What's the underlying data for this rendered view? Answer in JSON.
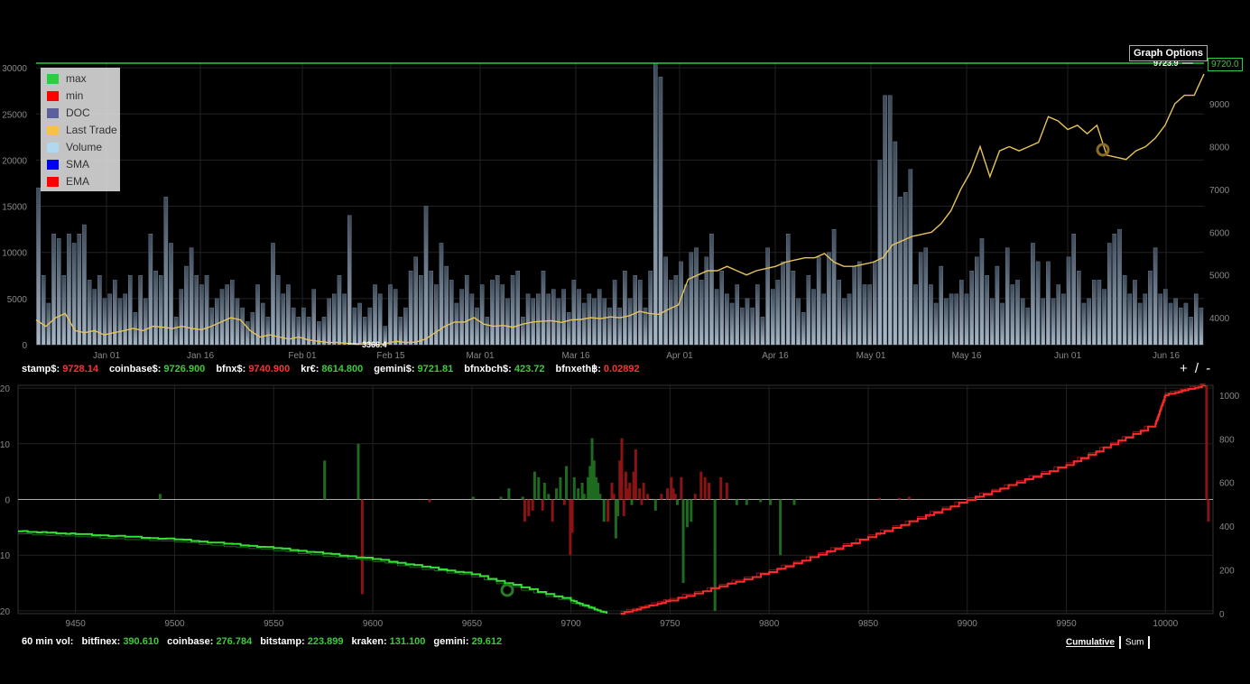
{
  "legend": [
    {
      "label": "max",
      "color": "#2ecc40"
    },
    {
      "label": "min",
      "color": "#ff0000"
    },
    {
      "label": "DOC",
      "color": "#5c5f99"
    },
    {
      "label": "Last Trade",
      "color": "#f5c242"
    },
    {
      "label": "Volume",
      "color": "#b0d8f0"
    },
    {
      "label": "SMA",
      "color": "#0000ff"
    },
    {
      "label": "EMA",
      "color": "#ff0000"
    }
  ],
  "graph_options_label": "Graph Options",
  "current_price_tag": "9720.0",
  "current_price_label": "9723.9",
  "min_price_label": "3366.4",
  "ticker": [
    {
      "label": "stamp$:",
      "value": "9728.14",
      "color": "red"
    },
    {
      "label": "coinbase$:",
      "value": "9726.900",
      "color": "green"
    },
    {
      "label": "bfnx$:",
      "value": "9740.900",
      "color": "red"
    },
    {
      "label": "kr€:",
      "value": "8614.800",
      "color": "green"
    },
    {
      "label": "gemini$:",
      "value": "9721.81",
      "color": "green"
    },
    {
      "label": "bfnxbch$:",
      "value": "423.72",
      "color": "green"
    },
    {
      "label": "bfnxeth฿:",
      "value": "0.02892",
      "color": "red"
    }
  ],
  "zoom_label": "+ / -",
  "volume_line": {
    "prefix": "60 min vol:",
    "items": [
      {
        "label": "bitfinex:",
        "value": "390.610"
      },
      {
        "label": "coinbase:",
        "value": "276.784"
      },
      {
        "label": "bitstamp:",
        "value": "223.899"
      },
      {
        "label": "kraken:",
        "value": "131.100"
      },
      {
        "label": "gemini:",
        "value": "29.612"
      }
    ]
  },
  "mode_cumulative": "Cumulative",
  "mode_sum": "Sum",
  "chart_data": [
    {
      "type": "bar",
      "x_ticks": [
        "Jan 01",
        "Jan 16",
        "Feb 01",
        "Feb 15",
        "Mar 01",
        "Mar 16",
        "Apr 01",
        "Apr 16",
        "May 01",
        "May 16",
        "Jun 01",
        "Jun 16"
      ],
      "y_left_ticks": [
        "0",
        "5000",
        "10000",
        "15000",
        "20000",
        "25000",
        "30000"
      ],
      "y_left_range": [
        0,
        30500
      ],
      "y_right_ticks": [
        "4000",
        "5000",
        "6000",
        "7000",
        "8000",
        "9000"
      ],
      "y_right_range": [
        3370,
        9950
      ],
      "volume_series": [
        17000,
        7500,
        4500,
        12000,
        11500,
        7500,
        12000,
        11000,
        12000,
        13000,
        7000,
        6000,
        7500,
        5000,
        5500,
        7000,
        5000,
        5500,
        7500,
        3500,
        7500,
        5000,
        12000,
        8000,
        7500,
        16000,
        11000,
        3000,
        6000,
        8500,
        10500,
        7500,
        6500,
        7500,
        4000,
        5000,
        6000,
        6500,
        7000,
        5000,
        4000,
        2500,
        3500,
        6500,
        4500,
        3000,
        11000,
        7500,
        5500,
        6500,
        4000,
        3000,
        4000,
        3000,
        6000,
        2500,
        3000,
        5000,
        5500,
        7500,
        5500,
        14000,
        4000,
        4500,
        3000,
        4000,
        6500,
        5500,
        2000,
        6500,
        6000,
        3000,
        4000,
        8000,
        9500,
        7500,
        15000,
        8000,
        6500,
        11000,
        8500,
        7000,
        4500,
        6000,
        7500,
        5500,
        4000,
        6500,
        3000,
        7000,
        7500,
        6500,
        5000,
        7500,
        8000,
        3000,
        5500,
        5000,
        5500,
        8000,
        5500,
        6000,
        5000,
        6000,
        3500,
        7000,
        6000,
        4500,
        5500,
        5000,
        6000,
        5000,
        4000,
        7000,
        4000,
        8000,
        5000,
        7500,
        7000,
        4000,
        8000,
        30500,
        29000,
        9500,
        7000,
        7500,
        9000,
        6500,
        10000,
        10500,
        7000,
        9500,
        12000,
        6000,
        8000,
        5500,
        4500,
        6500,
        4000,
        5000,
        4000,
        6500,
        3000,
        10500,
        6000,
        7000,
        9000,
        12000,
        8000,
        5000,
        3500,
        7500,
        6000,
        9500,
        5500,
        10000,
        12500,
        7000,
        5000,
        5500,
        8500,
        9000,
        6500,
        6500,
        9000,
        20000,
        27000,
        27000,
        22000,
        16000,
        16500,
        19000,
        6500,
        10000,
        10500,
        6500,
        4500,
        8500,
        5000,
        5500,
        5500,
        7000,
        5500,
        8000,
        9500,
        11500,
        7500,
        5000,
        8500,
        4500,
        10500,
        6500,
        7000,
        5000,
        4000,
        11000,
        9000,
        5000,
        9000,
        5000,
        6500,
        5500,
        9500,
        12000,
        8000,
        4500,
        5000,
        7000,
        7000,
        6000,
        11000,
        12000,
        12500,
        7500,
        5500,
        7000,
        4500,
        5500,
        8000,
        10500,
        5500,
        6000,
        4500,
        5000,
        4000,
        4500,
        3000,
        5500,
        4000
      ],
      "price_series": [
        3950,
        3800,
        4000,
        4100,
        3700,
        3650,
        3700,
        3600,
        3650,
        3700,
        3750,
        3700,
        3800,
        3780,
        3750,
        3800,
        3750,
        3720,
        3800,
        3900,
        4000,
        3950,
        3700,
        3550,
        3600,
        3550,
        3500,
        3550,
        3480,
        3450,
        3420,
        3420,
        3400,
        3380,
        3390,
        3366,
        3400,
        3450,
        3420,
        3430,
        3500,
        3650,
        3800,
        3900,
        3900,
        4000,
        3850,
        3800,
        3820,
        3780,
        3850,
        3900,
        3920,
        3930,
        3890,
        3950,
        3960,
        4000,
        3980,
        4020,
        4000,
        4050,
        4150,
        4100,
        4080,
        4200,
        4300,
        4900,
        5000,
        5100,
        5100,
        5200,
        5100,
        5000,
        5100,
        5150,
        5200,
        5300,
        5350,
        5400,
        5400,
        5500,
        5300,
        5200,
        5200,
        5250,
        5300,
        5400,
        5700,
        5800,
        5900,
        5950,
        6000,
        6200,
        6500,
        7000,
        7400,
        8000,
        7300,
        7900,
        8000,
        7900,
        8000,
        8100,
        8700,
        8600,
        8400,
        8500,
        8300,
        8500,
        7800,
        7750,
        7700,
        7900,
        8000,
        8200,
        8500,
        9000,
        9200,
        9200,
        9700
      ]
    },
    {
      "type": "area",
      "x_ticks": [
        "9450",
        "9500",
        "9550",
        "9600",
        "9650",
        "9700",
        "9750",
        "9800",
        "9850",
        "9900",
        "9950",
        "10000"
      ],
      "x_range": [
        9421,
        10024
      ],
      "y_left_ticks": [
        "-20",
        "-10",
        "0",
        "10",
        "20"
      ],
      "y_left_range": [
        -20.5,
        20.5
      ],
      "y_right_ticks": [
        "0",
        "200",
        "400",
        "600",
        "800",
        "1000"
      ],
      "y_right_range": [
        0,
        1045
      ],
      "bids_cumulative": [
        [
          9421,
          377
        ],
        [
          9450,
          364
        ],
        [
          9500,
          340
        ],
        [
          9550,
          300
        ],
        [
          9600,
          250
        ],
        [
          9650,
          180
        ],
        [
          9700,
          60
        ],
        [
          9718,
          0
        ]
      ],
      "asks_cumulative": [
        [
          9725,
          0
        ],
        [
          9750,
          60
        ],
        [
          9800,
          190
        ],
        [
          9850,
          350
        ],
        [
          9900,
          520
        ],
        [
          9950,
          680
        ],
        [
          9995,
          870
        ],
        [
          10000,
          1000
        ],
        [
          10020,
          1045
        ]
      ]
    }
  ]
}
